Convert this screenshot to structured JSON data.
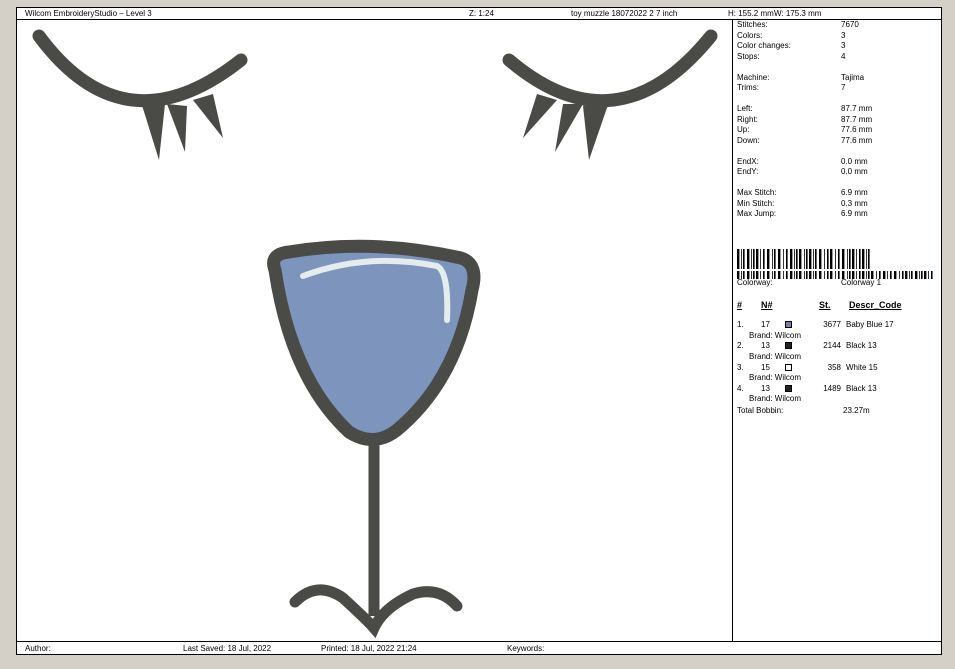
{
  "header": {
    "app_title": "Wilcom EmbroideryStudio – Level 3",
    "zoom": "Z: 1:24",
    "design_name": "toy muzzle 18072022 2 7 inch",
    "height": "H: 155.2 mm",
    "width": "W: 175.3 mm"
  },
  "stats": [
    {
      "label": "Stitches:",
      "value": "7670"
    },
    {
      "label": "Colors:",
      "value": "3"
    },
    {
      "label": "Color changes:",
      "value": "3"
    },
    {
      "label": "Stops:",
      "value": "4"
    },
    {
      "label": "Machine:",
      "value": "Tajima"
    },
    {
      "label": "Trims:",
      "value": "7"
    },
    {
      "label": "Left:",
      "value": "87.7 mm"
    },
    {
      "label": "Right:",
      "value": "87.7 mm"
    },
    {
      "label": "Up:",
      "value": "77.6 mm"
    },
    {
      "label": "Down:",
      "value": "77.6 mm"
    },
    {
      "label": "EndX:",
      "value": "0.0 mm"
    },
    {
      "label": "EndY:",
      "value": "0.0 mm"
    },
    {
      "label": "Max Stitch:",
      "value": "6.9 mm"
    },
    {
      "label": "Min Stitch:",
      "value": "0.3 mm"
    },
    {
      "label": "Max Jump:",
      "value": "6.9 mm"
    }
  ],
  "colorway": {
    "label": "Colorway:",
    "value": "Colorway 1"
  },
  "columns": {
    "index": "#",
    "number": "N#",
    "stitches": "St.",
    "descr": "Descr_Code"
  },
  "colors": [
    {
      "index": "1.",
      "number": "17",
      "swatch": "#6e86a8",
      "stitches": "3677",
      "descr": "Baby Blue 17",
      "brand": "Brand: Wilcom"
    },
    {
      "index": "2.",
      "number": "13",
      "swatch": "#222222",
      "stitches": "2144",
      "descr": "Black 13",
      "brand": "Brand: Wilcom"
    },
    {
      "index": "3.",
      "number": "15",
      "swatch": "#ffffff",
      "stitches": "358",
      "descr": "White 15",
      "brand": "Brand: Wilcom"
    },
    {
      "index": "4.",
      "number": "13",
      "swatch": "#222222",
      "stitches": "1489",
      "descr": "Black 13",
      "brand": "Brand: Wilcom"
    }
  ],
  "bobbin": {
    "label": "Total Bobbin:",
    "value": "23.27m"
  },
  "footer": {
    "author": "Author:",
    "last_saved": "Last Saved: 18 Jul, 2022",
    "printed": "Printed: 18 Jul, 2022 21:24",
    "keywords": "Keywords:"
  },
  "design_colors": {
    "outline": "#4a4a46",
    "fill": "#7d95bd",
    "highlight": "#e4ecec"
  }
}
